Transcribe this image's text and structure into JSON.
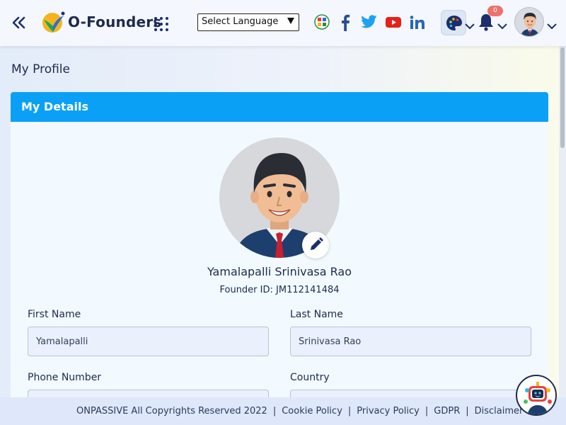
{
  "header": {
    "brand": "O-Founders",
    "language_select": "Select Language",
    "notification_count": "0"
  },
  "page": {
    "title": "My Profile"
  },
  "details": {
    "section_title": "My Details",
    "full_name": "Yamalapalli Srinivasa Rao",
    "founder_id": "Founder ID: JM112141484",
    "fields": {
      "first_name_label": "First Name",
      "first_name_value": "Yamalapalli",
      "last_name_label": "Last Name",
      "last_name_value": "Srinivasa Rao",
      "phone_label": "Phone Number",
      "country_label": "Country"
    }
  },
  "footer": {
    "copyright": "ONPASSIVE All Copyrights Reserved 2022",
    "cookie": "Cookie Policy",
    "privacy": "Privacy Policy",
    "gdpr": "GDPR",
    "disclaimer": "Disclaimer"
  },
  "colors": {
    "accent": "#0aa0f5",
    "brand_dark": "#1d2a4d",
    "badge": "#f0706e"
  },
  "icons": [
    "double-chevron-left-icon",
    "logo-icon",
    "apps-grid-icon",
    "globe-icon",
    "facebook-icon",
    "twitter-icon",
    "youtube-icon",
    "linkedin-icon",
    "palette-icon",
    "bell-icon",
    "avatar",
    "pencil-icon",
    "chatbot-icon"
  ]
}
